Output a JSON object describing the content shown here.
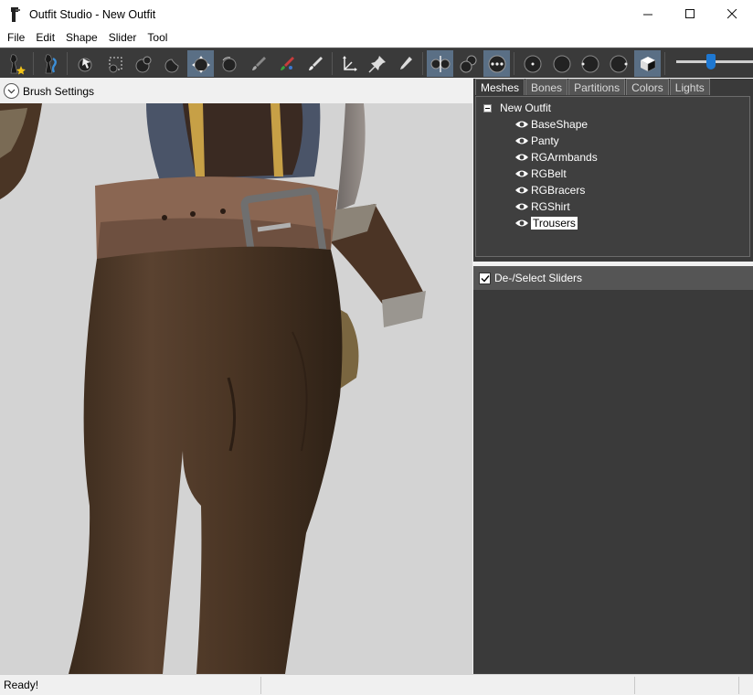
{
  "window": {
    "title": "Outfit Studio - New Outfit",
    "minimize": "—",
    "maximize": "☐",
    "close": "✕"
  },
  "menu": [
    "File",
    "Edit",
    "Shape",
    "Slider",
    "Tool"
  ],
  "toolbar": {
    "tools": [
      {
        "name": "new-project-tool",
        "icon": "figure-star-icon",
        "active": false
      },
      {
        "name": "load-outfit-tool",
        "icon": "figure-blue-icon",
        "active": false
      },
      {
        "name": "select-tool",
        "icon": "arrow-cursor-icon",
        "active": false
      },
      {
        "name": "mask-tool",
        "icon": "dotted-rect-icon",
        "active": false
      },
      {
        "name": "inflate-tool",
        "icon": "bump-icon",
        "active": false
      },
      {
        "name": "deflate-tool",
        "icon": "dent-icon",
        "active": false
      },
      {
        "name": "move-tool",
        "icon": "move-arrows-icon",
        "active": true
      },
      {
        "name": "smooth-tool",
        "icon": "smooth-sphere-icon",
        "active": false
      },
      {
        "name": "weight-paint-tool",
        "icon": "gray-brush-icon",
        "active": false
      },
      {
        "name": "color-paint-tool",
        "icon": "color-brush-icon",
        "active": false
      },
      {
        "name": "alpha-paint-tool",
        "icon": "white-brush-icon",
        "active": false
      },
      {
        "name": "transform-tool",
        "icon": "axes-icon",
        "active": false
      },
      {
        "name": "pivot-tool",
        "icon": "pin-icon",
        "active": false
      },
      {
        "name": "vertex-edit-tool",
        "icon": "pen-icon",
        "active": false
      },
      {
        "name": "x-mirror-tool",
        "icon": "mirror-icon",
        "active": true
      },
      {
        "name": "connected-only-tool",
        "icon": "connected-spheres-icon",
        "active": false
      },
      {
        "name": "global-brush-tool",
        "icon": "global-dots-icon",
        "active": true
      },
      {
        "name": "view-front-tool",
        "icon": "sphere-front-icon",
        "active": false
      },
      {
        "name": "view-back-tool",
        "icon": "sphere-back-icon",
        "active": false
      },
      {
        "name": "view-left-tool",
        "icon": "sphere-left-icon",
        "active": false
      },
      {
        "name": "view-right-tool",
        "icon": "sphere-right-icon",
        "active": false
      },
      {
        "name": "perspective-tool",
        "icon": "cube-icon",
        "active": true
      }
    ],
    "field_of_view_percent": 45
  },
  "brush_settings": {
    "label": "Brush Settings"
  },
  "tabs": [
    {
      "label": "Meshes",
      "active": true
    },
    {
      "label": "Bones",
      "active": false
    },
    {
      "label": "Partitions",
      "active": false
    },
    {
      "label": "Colors",
      "active": false
    },
    {
      "label": "Lights",
      "active": false
    }
  ],
  "tree": {
    "root": "New Outfit",
    "nodes": [
      {
        "label": "BaseShape",
        "selected": false
      },
      {
        "label": "Panty",
        "selected": false
      },
      {
        "label": "RGArmbands",
        "selected": false
      },
      {
        "label": "RGBelt",
        "selected": false
      },
      {
        "label": "RGBracers",
        "selected": false
      },
      {
        "label": "RGShirt",
        "selected": false
      },
      {
        "label": "Trousers",
        "selected": true
      }
    ]
  },
  "sliders": {
    "header": "De-/Select Sliders",
    "checked": true
  },
  "status": {
    "text": "Ready!"
  },
  "colors": {
    "toolbar_bg": "#3a3a3a",
    "active_tool": "#5a6f85",
    "slider_thumb": "#1e78d2",
    "viewport_bg": "#d3d3d3"
  }
}
